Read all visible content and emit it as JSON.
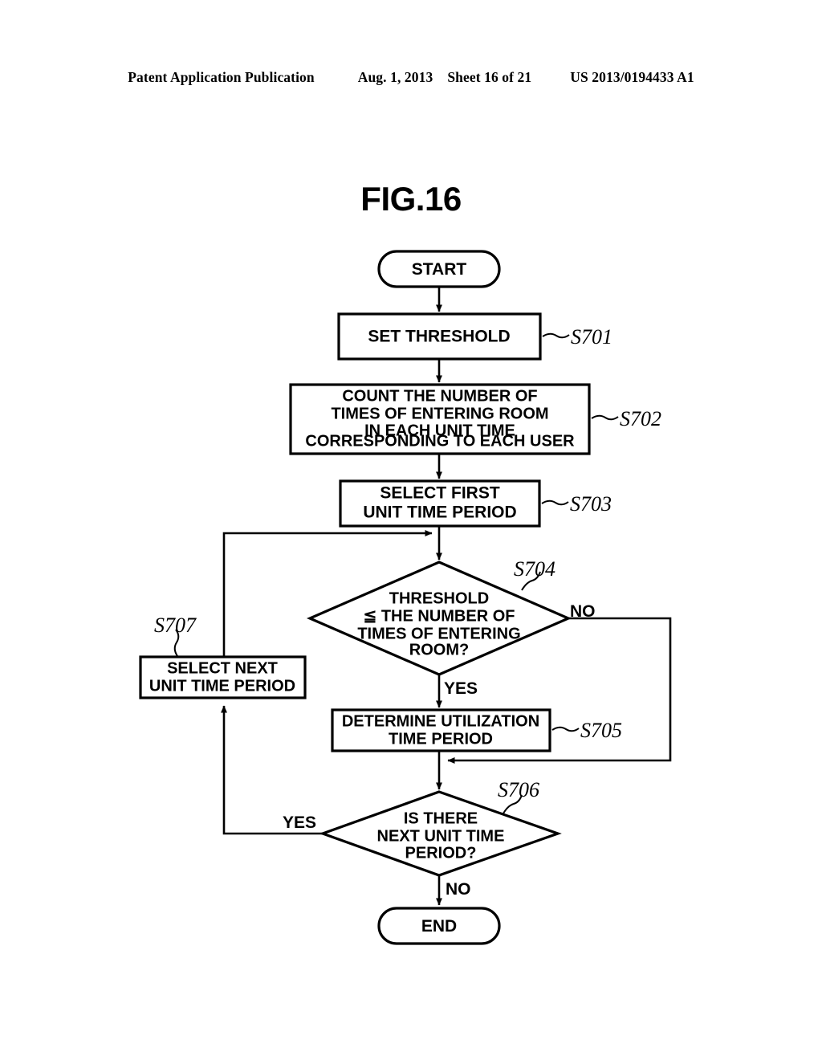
{
  "header": {
    "publication": "Patent Application Publication",
    "date": "Aug. 1, 2013",
    "sheet": "Sheet 16 of 21",
    "patent_number": "US 2013/0194433 A1"
  },
  "figure": {
    "title": "FIG.16"
  },
  "flowchart": {
    "start_label": "START",
    "end_label": "END",
    "nodes": {
      "s701": {
        "ref": "S701",
        "line1": "SET THRESHOLD"
      },
      "s702": {
        "ref": "S702",
        "line1": "COUNT THE NUMBER OF",
        "line2": "TIMES OF ENTERING ROOM",
        "line3": "IN EACH UNIT TIME",
        "line4": "CORRESPONDING TO EACH USER"
      },
      "s703": {
        "ref": "S703",
        "line1": "SELECT FIRST",
        "line2": "UNIT TIME PERIOD"
      },
      "s704": {
        "ref": "S704",
        "line1": "THRESHOLD",
        "line2": "≦ THE NUMBER OF",
        "line3": "TIMES OF ENTERING",
        "line4": "ROOM?"
      },
      "s705": {
        "ref": "S705",
        "line1": "DETERMINE UTILIZATION",
        "line2": "TIME PERIOD"
      },
      "s706": {
        "ref": "S706",
        "line1": "IS THERE",
        "line2": "NEXT UNIT TIME",
        "line3": "PERIOD?"
      },
      "s707": {
        "ref": "S707",
        "line1": "SELECT NEXT",
        "line2": "UNIT TIME PERIOD"
      }
    },
    "branches": {
      "s704_no": "NO",
      "s704_yes": "YES",
      "s706_yes": "YES",
      "s706_no": "NO"
    }
  },
  "colors": {
    "ink": "#000000",
    "paper": "#ffffff"
  }
}
